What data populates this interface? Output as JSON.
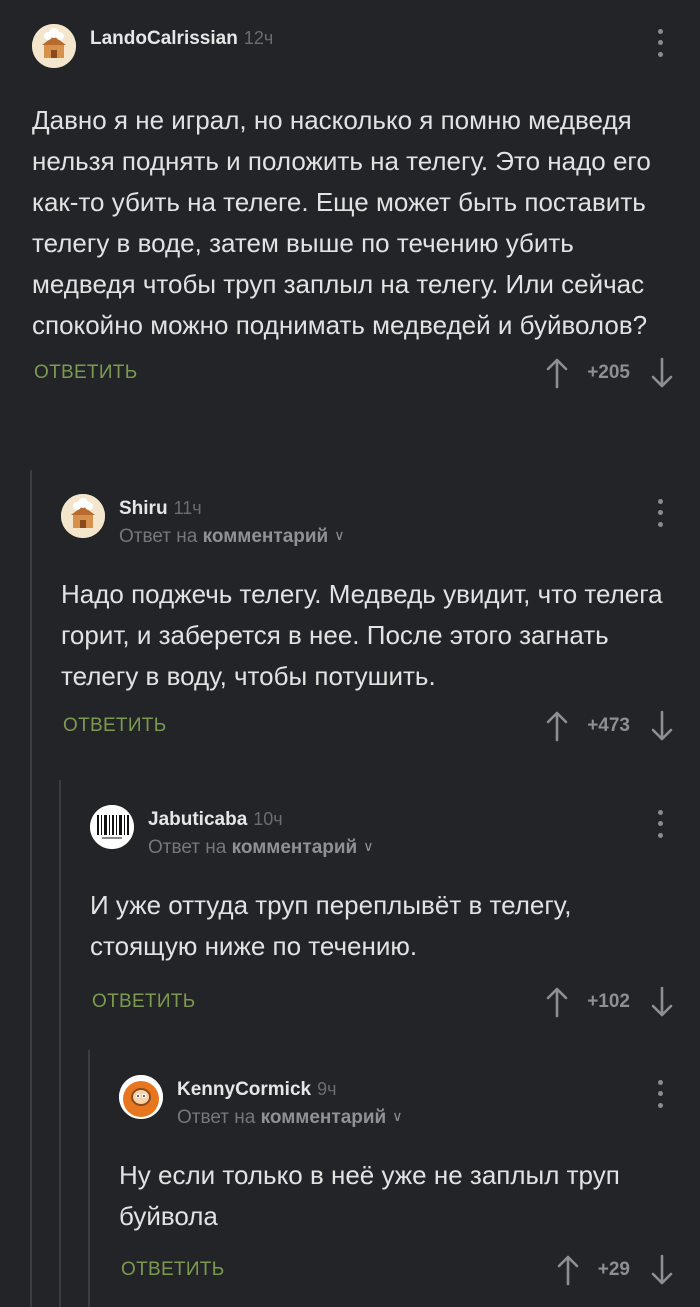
{
  "comments": [
    {
      "username": "LandoCalrissian",
      "time": "12ч",
      "reply_prefix": "",
      "reply_target": "",
      "text": "Давно я не играл, но насколько я помню медведя нельзя поднять и положить на телегу. Это надо его как-то убить на телеге. Еще может быть поставить телегу в воде, затем выше по течению убить медведя чтобы труп заплыл на телегу. Или сейчас спокойно можно поднимать медведей и буйволов?",
      "reply_label": "ОТВЕТИТЬ",
      "score": "+205",
      "avatar": "cabin-avatar-icon"
    },
    {
      "username": "Shiru",
      "time": "11ч",
      "reply_prefix": "Ответ на",
      "reply_target": "комментарий",
      "text": "Надо поджечь телегу. Медведь увидит, что телега горит, и заберется в нее. После этого загнать телегу в воду, чтобы потушить.",
      "reply_label": "ОТВЕТИТЬ",
      "score": "+473",
      "avatar": "cabin-avatar-icon"
    },
    {
      "username": "Jabuticaba",
      "time": "10ч",
      "reply_prefix": "Ответ на",
      "reply_target": "комментарий",
      "text": "И уже оттуда труп переплывёт в телегу, стоящую ниже по течению.",
      "reply_label": "ОТВЕТИТЬ",
      "score": "+102",
      "avatar": "barcode-avatar-icon"
    },
    {
      "username": "KennyCormick",
      "time": "9ч",
      "reply_prefix": "Ответ на",
      "reply_target": "комментарий",
      "text": "Ну если только в неё уже не заплыл труп буйвола",
      "reply_label": "ОТВЕТИТЬ",
      "score": "+29",
      "avatar": "kenny-avatar-icon"
    }
  ],
  "colors": {
    "background": "#232427",
    "reply_link": "#7c9a4f",
    "thread_line": "#3c3d40"
  }
}
